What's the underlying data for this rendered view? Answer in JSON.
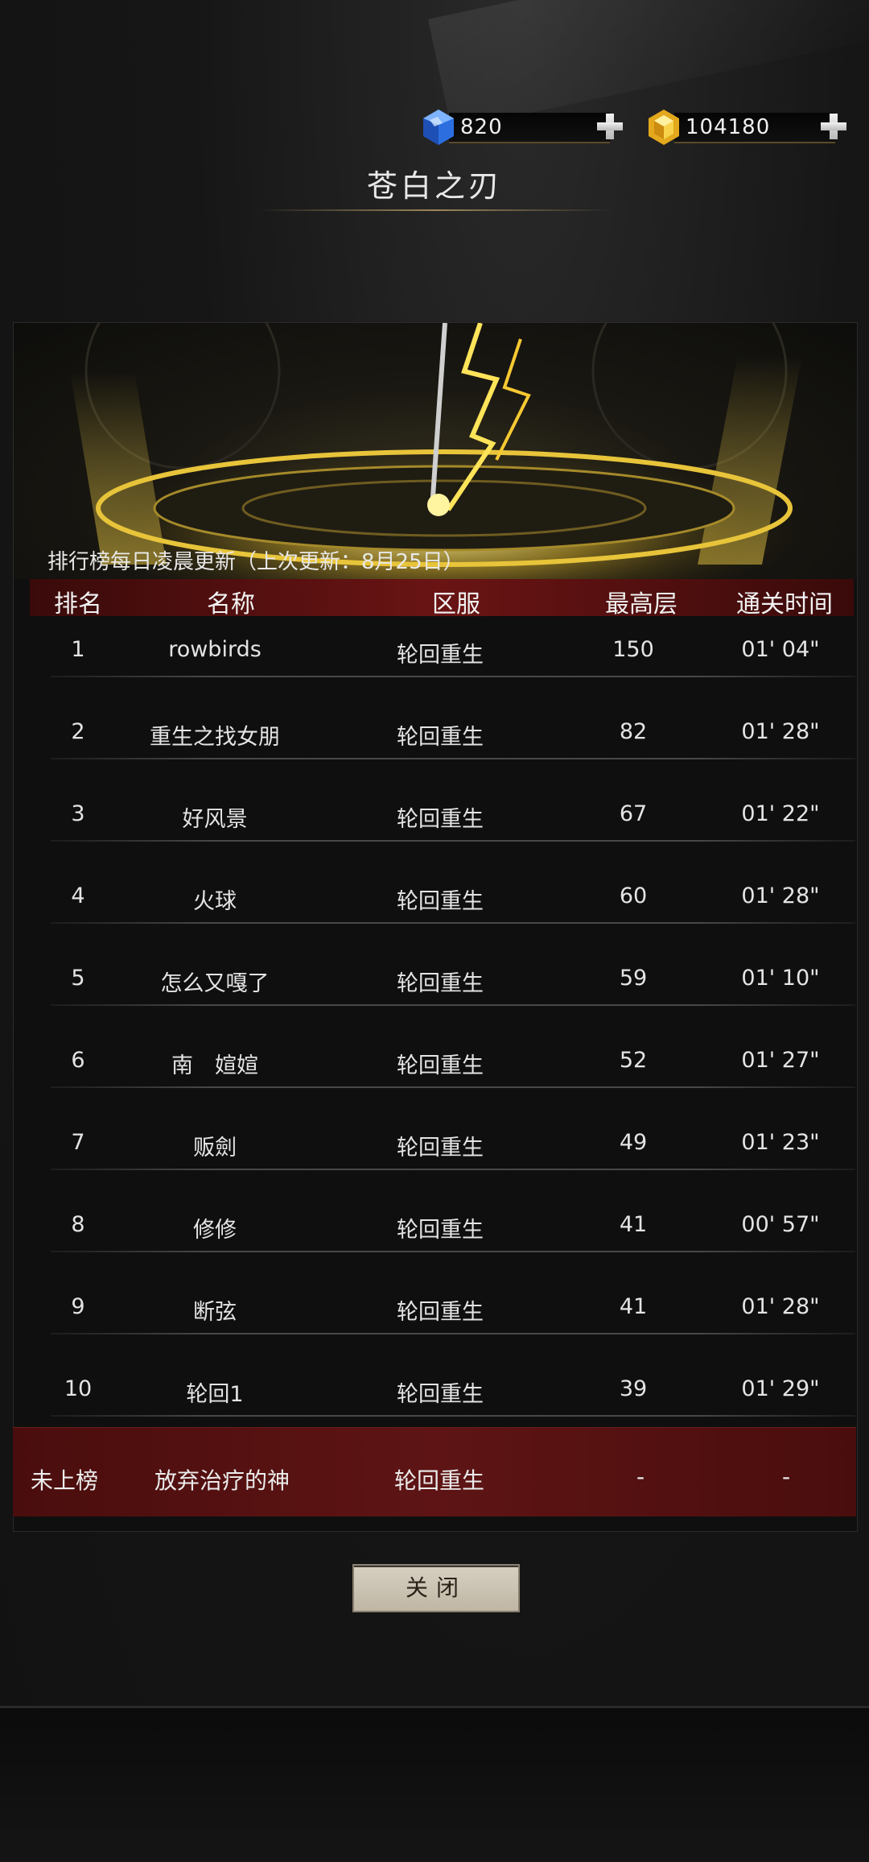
{
  "currency": {
    "gems": {
      "icon": "blue-gem-icon",
      "value": "820"
    },
    "gold": {
      "icon": "gold-gem-icon",
      "value": "104180"
    }
  },
  "title": "苍白之刃",
  "banner": {
    "note": "排行榜每日凌晨更新（上次更新：8月25日）"
  },
  "table": {
    "headers": [
      "排名",
      "名称",
      "区服",
      "最高层",
      "通关时间"
    ],
    "rows": [
      {
        "rank": "1",
        "name": "rowbirds",
        "server": "轮回重生",
        "floor": "150",
        "time": "01' 04\""
      },
      {
        "rank": "2",
        "name": "重生之找女朋",
        "server": "轮回重生",
        "floor": "82",
        "time": "01' 28\""
      },
      {
        "rank": "3",
        "name": "好风景",
        "server": "轮回重生",
        "floor": "67",
        "time": "01' 22\""
      },
      {
        "rank": "4",
        "name": "火球",
        "server": "轮回重生",
        "floor": "60",
        "time": "01' 28\""
      },
      {
        "rank": "5",
        "name": "怎么又嘎了",
        "server": "轮回重生",
        "floor": "59",
        "time": "01' 10\""
      },
      {
        "rank": "6",
        "name": "南　媗媗",
        "server": "轮回重生",
        "floor": "52",
        "time": "01' 27\""
      },
      {
        "rank": "7",
        "name": "贩劍",
        "server": "轮回重生",
        "floor": "49",
        "time": "01' 23\""
      },
      {
        "rank": "8",
        "name": "修修",
        "server": "轮回重生",
        "floor": "41",
        "time": "00' 57\""
      },
      {
        "rank": "9",
        "name": "断弦",
        "server": "轮回重生",
        "floor": "41",
        "time": "01' 28\""
      },
      {
        "rank": "10",
        "name": "轮回1",
        "server": "轮回重生",
        "floor": "39",
        "time": "01' 29\""
      }
    ]
  },
  "self_row": {
    "rank": "未上榜",
    "name": "放弃治疗的神",
    "server": "轮回重生",
    "floor": "-",
    "time": "-"
  },
  "close_button": {
    "label": "关闭"
  },
  "colors": {
    "header_red": "#6a1414",
    "self_row_red": "#5e1414",
    "gold_accent": "#f5d23a",
    "button_bg": "#d7d0c2"
  }
}
